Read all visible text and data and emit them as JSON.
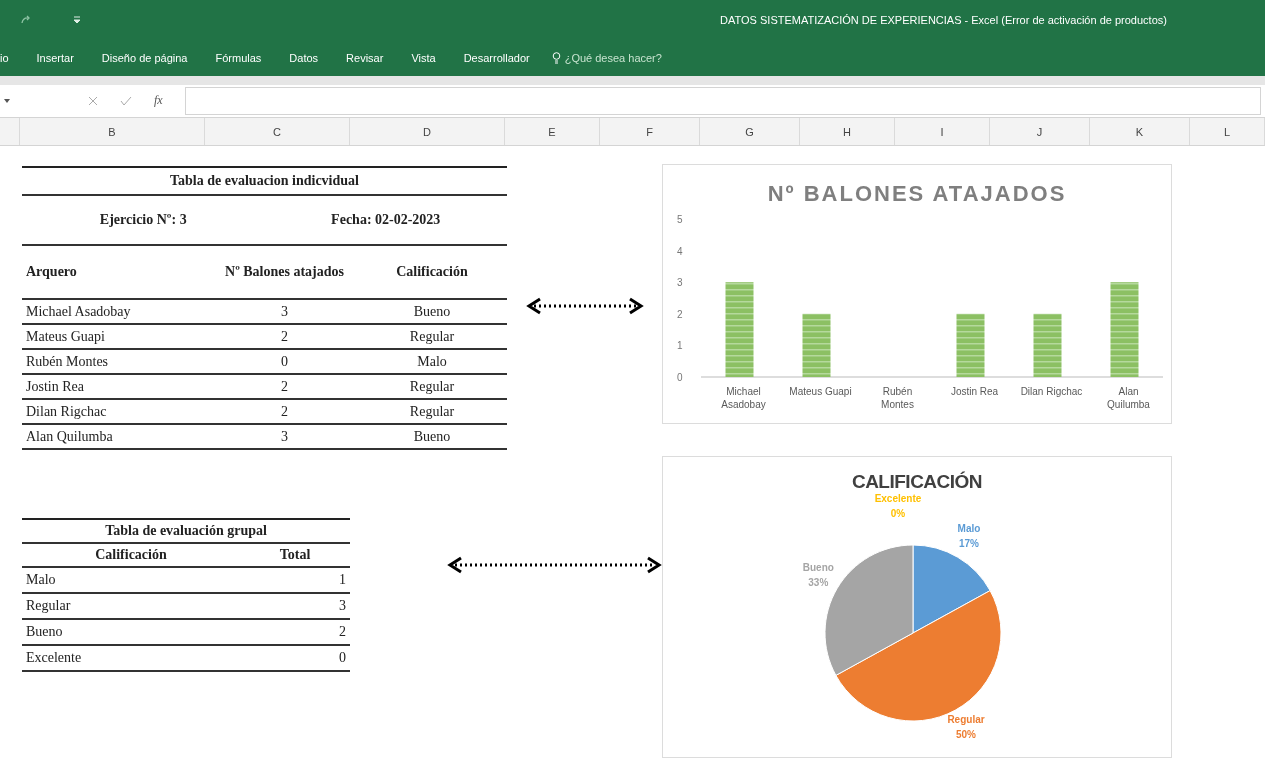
{
  "window": {
    "title": "DATOS SISTEMATIZACIÓN DE EXPERIENCIAS - Excel (Error de activación de productos)"
  },
  "ribbon_tabs": [
    {
      "label": "io"
    },
    {
      "label": "Insertar"
    },
    {
      "label": "Diseño de página"
    },
    {
      "label": "Fórmulas"
    },
    {
      "label": "Datos"
    },
    {
      "label": "Revisar"
    },
    {
      "label": "Vista"
    },
    {
      "label": "Desarrollador"
    }
  ],
  "tell_me": {
    "placeholder": "¿Qué desea hacer?"
  },
  "formula_bar": {
    "function_label": "fx"
  },
  "columns": [
    "",
    "B",
    "C",
    "D",
    "E",
    "F",
    "G",
    "H",
    "I",
    "J",
    "K",
    "L"
  ],
  "individual_table": {
    "title": "Tabla de evaluacion indicvidual",
    "exercise": "Ejercicio Nº: 3",
    "date": "Fecha: 02-02-2023",
    "headers": [
      "Arquero",
      "Nº Balones atajados",
      "Calificación"
    ],
    "rows": [
      [
        "Michael Asadobay",
        "3",
        "Bueno"
      ],
      [
        "Mateus Guapi",
        "2",
        "Regular"
      ],
      [
        "Rubén Montes",
        "0",
        "Malo"
      ],
      [
        "Jostin Rea",
        "2",
        "Regular"
      ],
      [
        "Dilan Rigchac",
        "2",
        "Regular"
      ],
      [
        "Alan Quilumba",
        "3",
        "Bueno"
      ]
    ]
  },
  "group_table": {
    "title": "Tabla de evaluación grupal",
    "headers": [
      "Calificación",
      "Total"
    ],
    "rows": [
      [
        "Malo",
        "1"
      ],
      [
        "Regular",
        "3"
      ],
      [
        "Bueno",
        "2"
      ],
      [
        "Excelente",
        "0"
      ]
    ]
  },
  "bar_chart": {
    "chart_data": {
      "type": "bar",
      "title": "Nº BALONES ATAJADOS",
      "categories": [
        "Michael Asadobay",
        "Mateus Guapi",
        "Rubén Montes",
        "Jostin Rea",
        "Dilan Rigchac",
        "Alan Quilumba"
      ],
      "series": [
        {
          "color": "#8cc063",
          "values": [
            3,
            2,
            0,
            2,
            2,
            3
          ]
        }
      ],
      "ylim": [
        0,
        5
      ],
      "yticks": [
        0,
        1,
        2,
        3,
        4,
        5
      ]
    }
  },
  "pie_chart": {
    "chart_data": {
      "type": "pie",
      "title": "CALIFICACIÓN",
      "categories": [
        "Malo",
        "Regular",
        "Bueno",
        "Excelente"
      ],
      "series": [
        {
          "values": [
            17,
            50,
            33,
            0
          ]
        }
      ],
      "colors": [
        "#5b9bd5",
        "#ed7d31",
        "#a5a5a5",
        "#ffc000"
      ],
      "value_labels": [
        "17%",
        "50%",
        "33%",
        "0%"
      ]
    }
  }
}
